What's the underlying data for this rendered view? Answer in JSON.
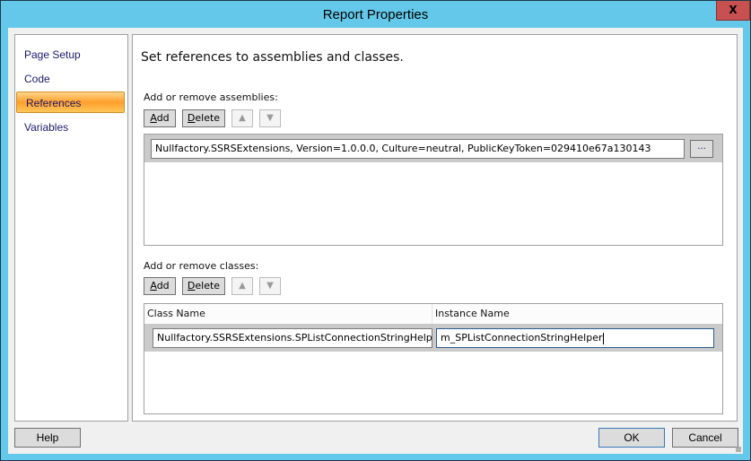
{
  "window": {
    "title": "Report Properties",
    "close_label": "X"
  },
  "nav": {
    "items": [
      {
        "label": "Page Setup",
        "selected": false
      },
      {
        "label": "Code",
        "selected": false
      },
      {
        "label": "References",
        "selected": true
      },
      {
        "label": "Variables",
        "selected": false
      }
    ]
  },
  "main": {
    "heading": "Set references to assemblies and classes.",
    "assemblies": {
      "label": "Add or remove assemblies:",
      "add_label_underlined": "A",
      "add_label_rest": "dd",
      "delete_label_underlined": "D",
      "delete_label_rest": "elete",
      "move_up_icon": "▲",
      "move_down_icon": "▼",
      "items": [
        {
          "value": "Nullfactory.SSRSExtensions, Version=1.0.0.0, Culture=neutral, PublicKeyToken=029410e67a130143"
        }
      ],
      "browse_label": "..."
    },
    "classes": {
      "label": "Add or remove classes:",
      "add_label_underlined": "A",
      "add_label_rest": "dd",
      "delete_label_underlined": "D",
      "delete_label_rest": "elete",
      "move_up_icon": "▲",
      "move_down_icon": "▼",
      "columns": [
        "Class Name",
        "Instance Name"
      ],
      "rows": [
        {
          "class_name": "Nullfactory.SSRSExtensions.SPListConnectionStringHelper",
          "instance_name": "m_SPListConnectionStringHelper"
        }
      ]
    }
  },
  "footer": {
    "help_label": "Help",
    "ok_label": "OK",
    "cancel_label": "Cancel"
  }
}
